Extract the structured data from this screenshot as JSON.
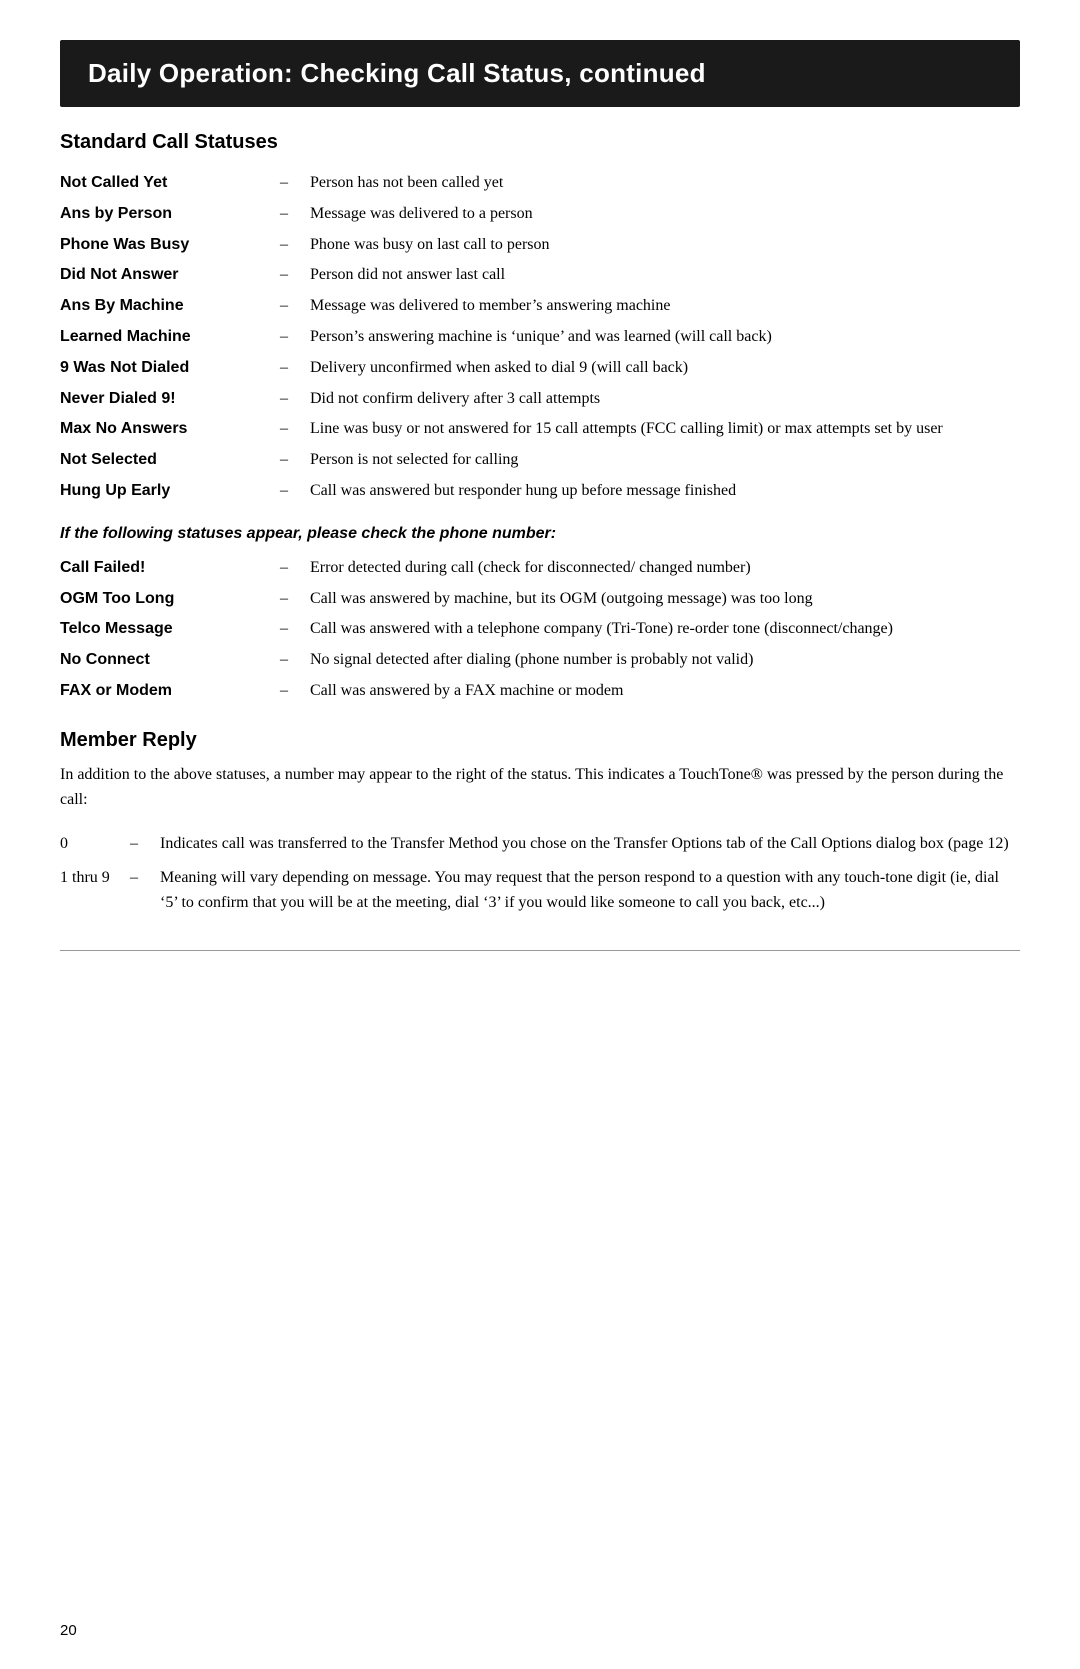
{
  "header": {
    "title": "Daily Operation: Checking Call Status, continued",
    "bg": "#1a1a1a"
  },
  "standard_section": {
    "title": "Standard Call Statuses",
    "statuses": [
      {
        "term": "Not Called Yet",
        "desc": "Person has not been called yet"
      },
      {
        "term": "Ans by Person",
        "desc": "Message was delivered to a person"
      },
      {
        "term": "Phone Was Busy",
        "desc": "Phone was busy on last call to person"
      },
      {
        "term": "Did Not Answer",
        "desc": "Person did not answer last call"
      },
      {
        "term": "Ans By Machine",
        "desc": "Message was delivered to member’s answering machine"
      },
      {
        "term": "Learned Machine",
        "desc": "Person’s answering machine is ‘unique’ and was learned (will call back)"
      },
      {
        "term": "9 Was Not Dialed",
        "desc": "Delivery unconfirmed when asked to dial 9 (will call back)"
      },
      {
        "term": "Never Dialed 9!",
        "desc": "Did not confirm delivery after 3 call attempts"
      },
      {
        "term": "Max No Answers",
        "desc": "Line was busy or not answered for 15 call attempts (FCC calling limit) or max attempts set by user"
      },
      {
        "term": "Not Selected",
        "desc": "Person is not selected for calling"
      },
      {
        "term": "Hung Up Early",
        "desc": "Call was answered but responder hung up before message finished"
      }
    ]
  },
  "phone_check_section": {
    "heading": "If the following statuses appear, please check the phone number:",
    "statuses": [
      {
        "term": "Call Failed!",
        "desc": "Error detected during call (check for disconnected/ changed number)"
      },
      {
        "term": "OGM Too Long",
        "desc": "Call was answered by machine, but its OGM (outgoing message) was too long"
      },
      {
        "term": "Telco Message",
        "desc": "Call was answered with a telephone company (Tri-Tone) re-order tone (disconnect/change)"
      },
      {
        "term": "No Connect",
        "desc": "No signal detected after dialing (phone number is probably not valid)"
      },
      {
        "term": "FAX or Modem",
        "desc": "Call was answered by a FAX machine or modem"
      }
    ]
  },
  "member_reply_section": {
    "title": "Member Reply",
    "intro": "In addition to the above statuses, a number may appear to the right of the status. This indicates a TouchTone® was pressed by the person during the call:",
    "items": [
      {
        "num": "0",
        "desc": "Indicates call was transferred to the Transfer Method you chose on the Transfer Options tab of the Call Options dialog box (page 12)"
      },
      {
        "num": "1 thru 9",
        "desc": "Meaning will vary depending on message. You may request that the person respond to a question with any touch-tone digit (ie, dial ‘5’ to confirm that you will be at the meeting, dial ‘3’ if you would like someone to call you back, etc...)"
      }
    ]
  },
  "page_number": "20",
  "dash": "–"
}
